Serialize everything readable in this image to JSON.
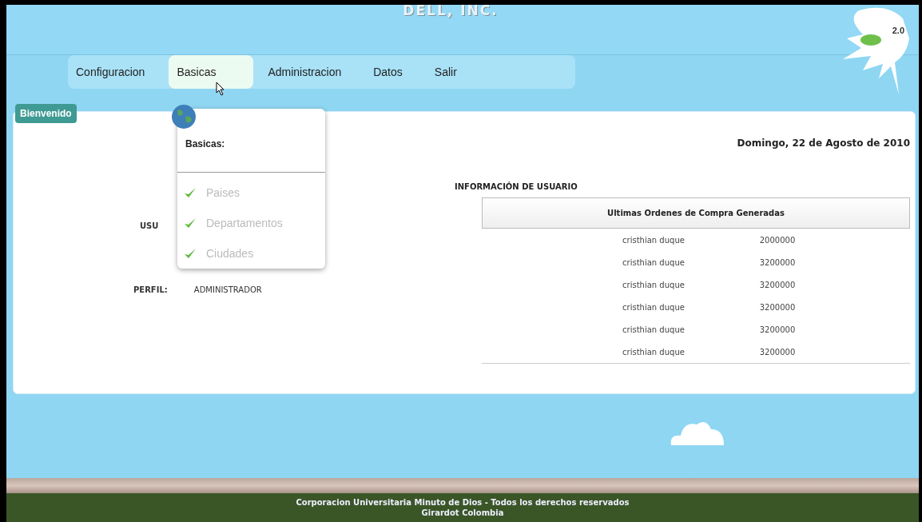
{
  "header": {
    "title": "DELL, INC."
  },
  "logo": {
    "text": "2.0"
  },
  "nav": [
    {
      "label": "Configuracion",
      "selected": false
    },
    {
      "label": "Basicas",
      "selected": true
    },
    {
      "label": "Administracion",
      "selected": false
    },
    {
      "label": "Datos",
      "selected": false
    },
    {
      "label": "Salir",
      "selected": false
    }
  ],
  "dropdown": {
    "title": "Basicas:",
    "items": [
      {
        "label": "Paises",
        "checked": true
      },
      {
        "label": "Departamentos",
        "checked": true
      },
      {
        "label": "Ciudades",
        "checked": true
      }
    ]
  },
  "panel": {
    "tab": "Bienvenido",
    "date": "Domingo, 22 de Agosto de 2010",
    "user_label": "USU",
    "profile_label": "PERFIL:",
    "profile_value": "ADMINISTRADOR",
    "info_title": "INFORMACIÓN DE USUARIO"
  },
  "table": {
    "title": "Ultimas Ordenes de Compra Generadas",
    "rows": [
      [
        "cristhian duque",
        "2000000"
      ],
      [
        "cristhian duque",
        "3200000"
      ],
      [
        "cristhian duque",
        "3200000"
      ],
      [
        "cristhian duque",
        "3200000"
      ],
      [
        "cristhian duque",
        "3200000"
      ],
      [
        "cristhian duque",
        "3200000"
      ]
    ]
  },
  "footer": {
    "lines": [
      "Corporacion Universitaria Minuto de Dios - Todos los derechos reservados",
      "Girardot Colombia"
    ]
  }
}
